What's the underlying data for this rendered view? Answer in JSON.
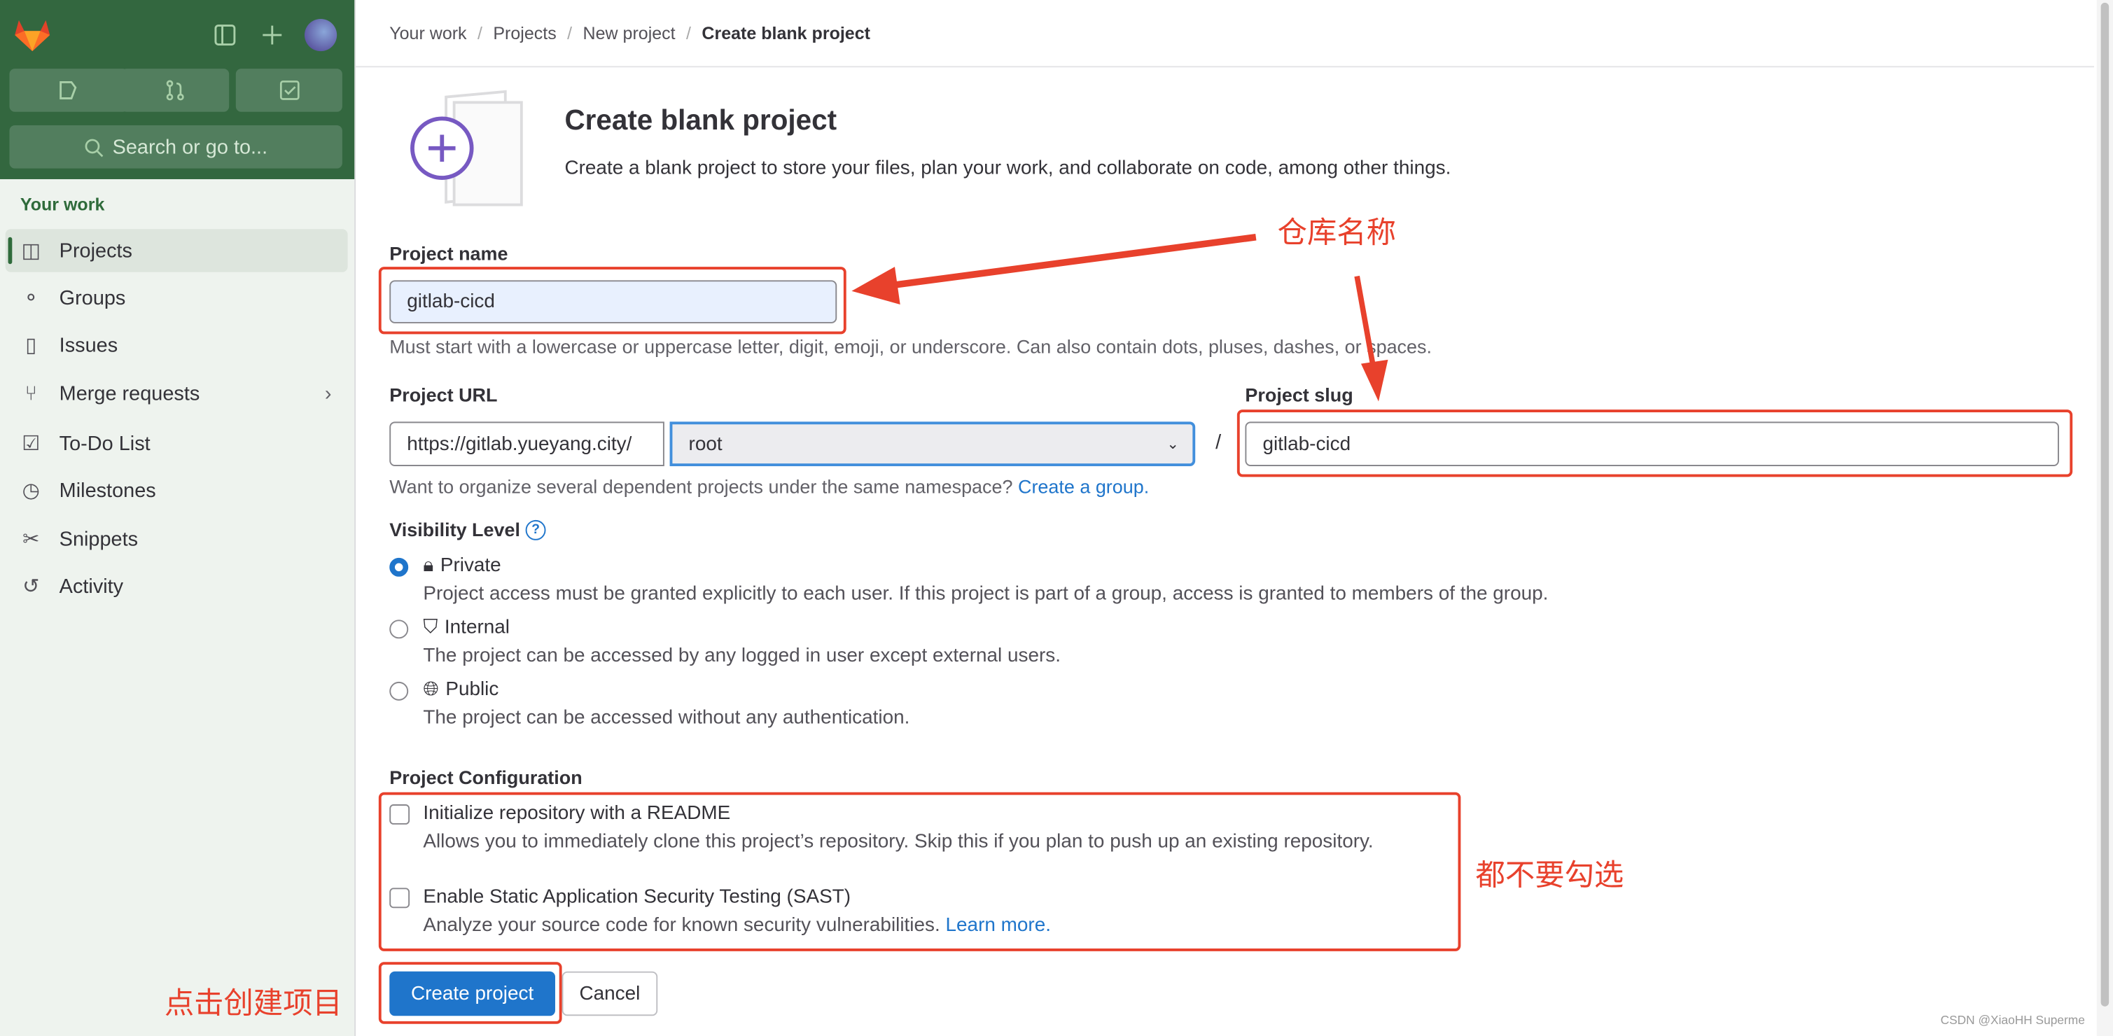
{
  "sidebar": {
    "search_placeholder": "Search or go to...",
    "section_title": "Your work",
    "items": [
      {
        "label": "Projects",
        "icon": "project-icon",
        "active": true
      },
      {
        "label": "Groups",
        "icon": "group-icon"
      },
      {
        "label": "Issues",
        "icon": "issues-icon"
      },
      {
        "label": "Merge requests",
        "icon": "merge-request-icon"
      },
      {
        "label": "To-Do List",
        "icon": "todo-icon"
      },
      {
        "label": "Milestones",
        "icon": "clock-icon"
      },
      {
        "label": "Snippets",
        "icon": "snippet-icon"
      },
      {
        "label": "Activity",
        "icon": "history-icon"
      }
    ]
  },
  "breadcrumb": [
    "Your work",
    "Projects",
    "New project",
    "Create blank project"
  ],
  "header": {
    "title": "Create blank project",
    "description": "Create a blank project to store your files, plan your work, and collaborate on code, among other things."
  },
  "form": {
    "project_name_label": "Project name",
    "project_name_value": "gitlab-cicd",
    "project_name_help": "Must start with a lowercase or uppercase letter, digit, emoji, or underscore. Can also contain dots, pluses, dashes, or spaces.",
    "project_url_label": "Project URL",
    "url_prefix": "https://gitlab.yueyang.city/",
    "namespace_value": "root",
    "slash": "/",
    "project_slug_label": "Project slug",
    "project_slug_value": "gitlab-cicd",
    "namespace_help": "Want to organize several dependent projects under the same namespace?",
    "create_group_link": "Create a group.",
    "visibility_label": "Visibility Level",
    "visibility": [
      {
        "label": "Private",
        "desc": "Project access must be granted explicitly to each user. If this project is part of a group, access is granted to members of the group.",
        "selected": true
      },
      {
        "label": "Internal",
        "desc": "The project can be accessed by any logged in user except external users.",
        "selected": false
      },
      {
        "label": "Public",
        "desc": "The project can be accessed without any authentication.",
        "selected": false
      }
    ],
    "config_label": "Project Configuration",
    "config": [
      {
        "label": "Initialize repository with a README",
        "desc": "Allows you to immediately clone this project’s repository. Skip this if you plan to push up an existing repository.",
        "checked": false
      },
      {
        "label": "Enable Static Application Security Testing (SAST)",
        "desc": "Analyze your source code for known security vulnerabilities.",
        "link": "Learn more.",
        "checked": false
      }
    ],
    "create_button": "Create project",
    "cancel_button": "Cancel"
  },
  "annotations": {
    "repo_name": "仓库名称",
    "no_check": "都不要勾选",
    "click_create": "点击创建项目"
  },
  "watermark": "CSDN @XiaoHH Superme",
  "colors": {
    "sidebar_header": "#33673f",
    "primary": "#1f75cb",
    "annotation": "#e8412c"
  }
}
